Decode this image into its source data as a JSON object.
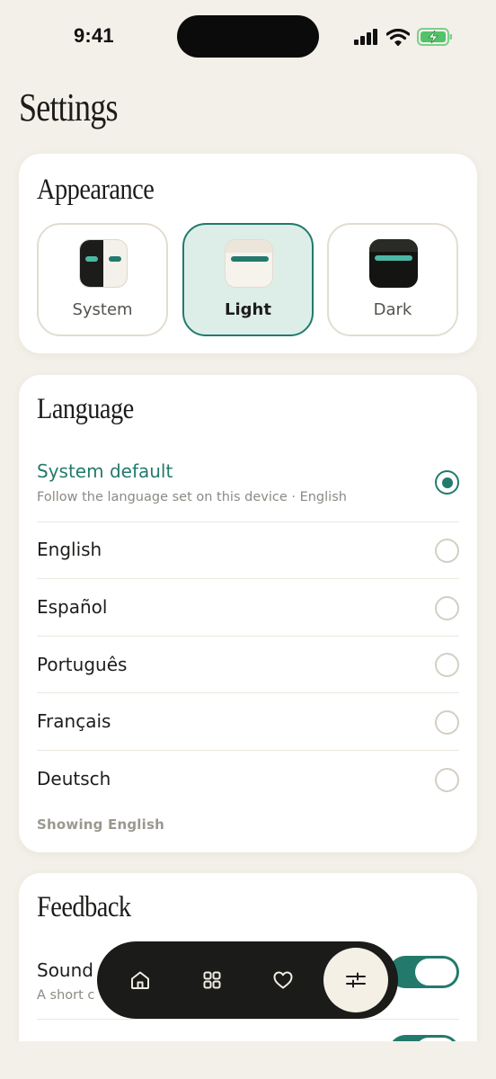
{
  "status": {
    "time": "9:41"
  },
  "page": {
    "title": "Settings"
  },
  "appearance": {
    "title": "Appearance",
    "options": [
      {
        "label": "System",
        "selected": false
      },
      {
        "label": "Light",
        "selected": true
      },
      {
        "label": "Dark",
        "selected": false
      }
    ]
  },
  "language": {
    "title": "Language",
    "default_label": "System default",
    "default_sub": "Follow the language set on this device · English",
    "items": [
      "English",
      "Español",
      "Português",
      "Français",
      "Deutsch"
    ],
    "selected": "System default",
    "footnote": "Showing English"
  },
  "feedback": {
    "title": "Feedback",
    "items": [
      {
        "label": "Sound",
        "sub": "A short c",
        "enabled": true
      }
    ]
  },
  "tabbar": {
    "items": [
      "home-icon",
      "grid-icon",
      "heart-icon",
      "sliders-icon"
    ],
    "active": "sliders-icon"
  },
  "colors": {
    "accent": "#237a6c",
    "background": "#f3f0e9",
    "tabbar": "#1b1b19"
  }
}
